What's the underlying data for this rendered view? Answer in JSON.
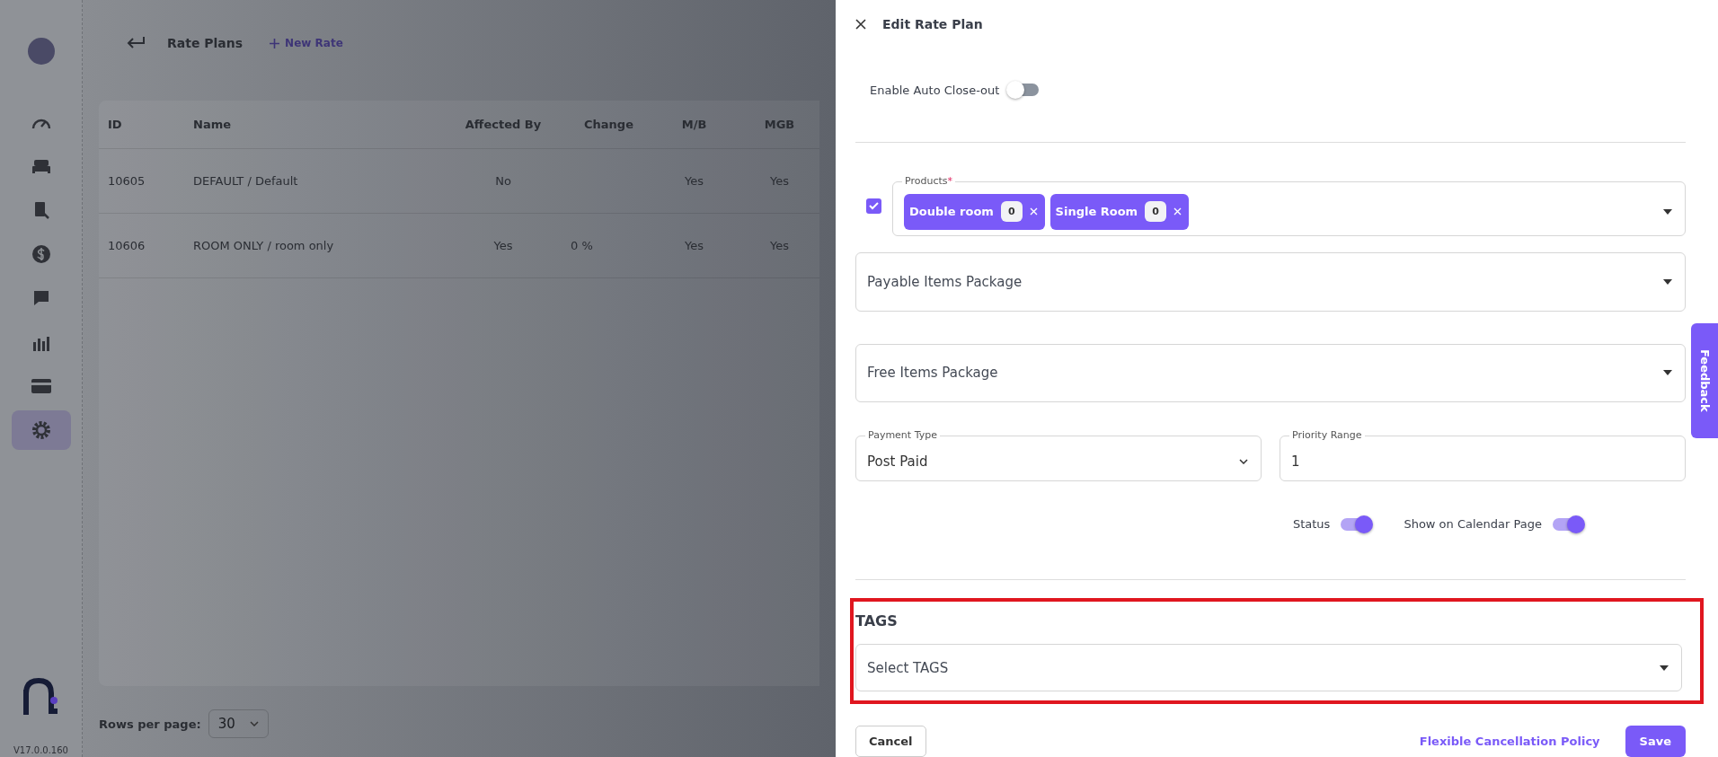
{
  "sidebar": {
    "items": [
      {
        "kind": "gauge",
        "selected": false
      },
      {
        "kind": "bed",
        "selected": false
      },
      {
        "kind": "book",
        "selected": false
      },
      {
        "kind": "coin",
        "selected": false
      },
      {
        "kind": "chat",
        "selected": false
      },
      {
        "kind": "chart",
        "selected": false
      },
      {
        "kind": "card",
        "selected": false
      },
      {
        "kind": "gear",
        "selected": true
      }
    ],
    "version": "V17.0.0.160"
  },
  "page": {
    "title": "Rate Plans",
    "new_button": "New Rate"
  },
  "table": {
    "columns": [
      "ID",
      "Name",
      "Affected By",
      "Change",
      "M/B",
      "MGB"
    ],
    "rows": [
      [
        "10605",
        "DEFAULT / Default",
        "No",
        "",
        "Yes",
        "Yes"
      ],
      [
        "10606",
        "ROOM ONLY / room only",
        "Yes",
        "0 %",
        "Yes",
        "Yes"
      ]
    ]
  },
  "pagination": {
    "label": "Rows per page:",
    "value": "30"
  },
  "panel": {
    "title": "Edit Rate Plan",
    "auto_close": {
      "label": "Enable Auto Close-out",
      "on": false
    },
    "products": {
      "checked": true,
      "label": "Products",
      "required": "*",
      "chips": [
        {
          "label": "Double room",
          "count": "0"
        },
        {
          "label": "Single Room",
          "count": "0"
        }
      ]
    },
    "payable": {
      "placeholder": "Payable Items Package"
    },
    "free": {
      "placeholder": "Free Items Package"
    },
    "payment_type": {
      "label": "Payment Type",
      "value": "Post Paid"
    },
    "priority_range": {
      "label": "Priority Range",
      "value": "1"
    },
    "toggles": [
      {
        "label": "Status",
        "on": true
      },
      {
        "label": "Show on Calendar Page",
        "on": true
      }
    ],
    "tags": {
      "heading": "TAGS",
      "placeholder": "Select TAGS",
      "highlighted": true
    },
    "buttons": {
      "cancel": "Cancel",
      "policy": "Flexible Cancellation Policy",
      "save": "Save"
    }
  },
  "feedback": "Feedback"
}
